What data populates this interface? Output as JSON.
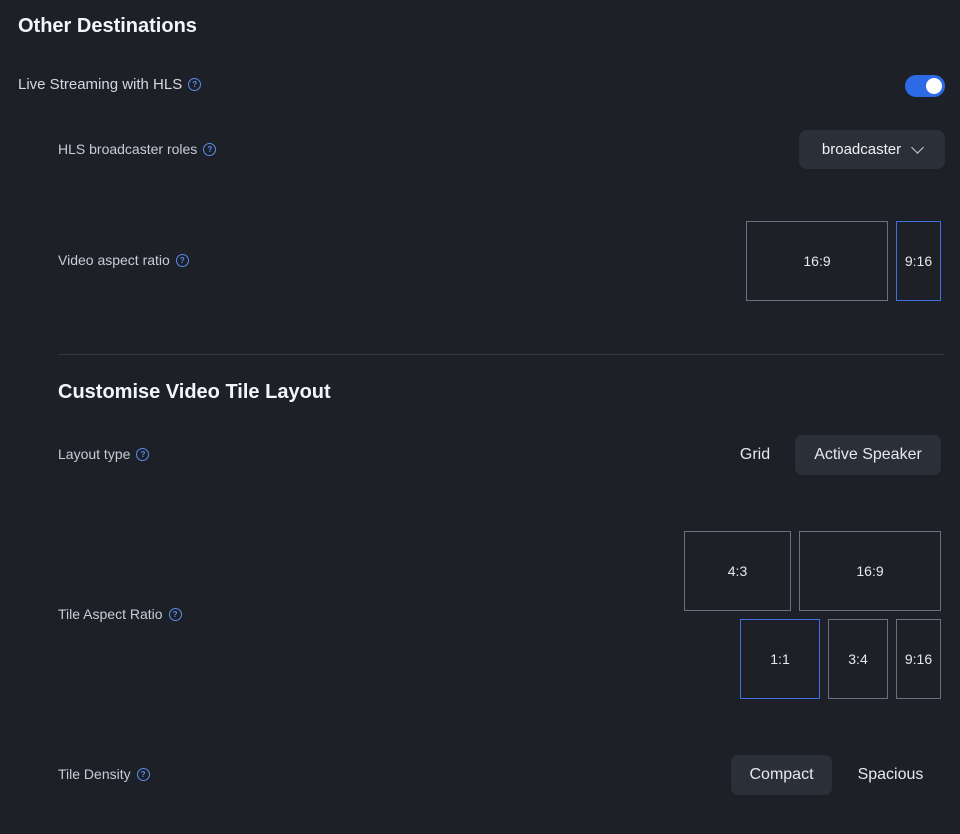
{
  "section_title": "Other Destinations",
  "hls": {
    "label": "Live Streaming with HLS",
    "enabled": true
  },
  "broadcaster_roles": {
    "label": "HLS broadcaster roles",
    "selected": "broadcaster"
  },
  "video_aspect": {
    "label": "Video aspect ratio",
    "options": [
      "16:9",
      "9:16"
    ],
    "selected": "9:16"
  },
  "tile_layout": {
    "title": "Customise Video Tile Layout",
    "layout_type": {
      "label": "Layout type",
      "options": [
        "Grid",
        "Active Speaker"
      ],
      "selected": "Active Speaker"
    },
    "tile_aspect": {
      "label": "Tile Aspect Ratio",
      "options": [
        "4:3",
        "16:9",
        "1:1",
        "3:4",
        "9:16"
      ],
      "selected": "1:1"
    },
    "tile_density": {
      "label": "Tile Density",
      "options": [
        "Compact",
        "Spacious"
      ],
      "selected": "Compact"
    }
  },
  "colors": {
    "background": "#1d2027",
    "accent": "#2d6be6",
    "control_bg": "#2b2f38"
  }
}
